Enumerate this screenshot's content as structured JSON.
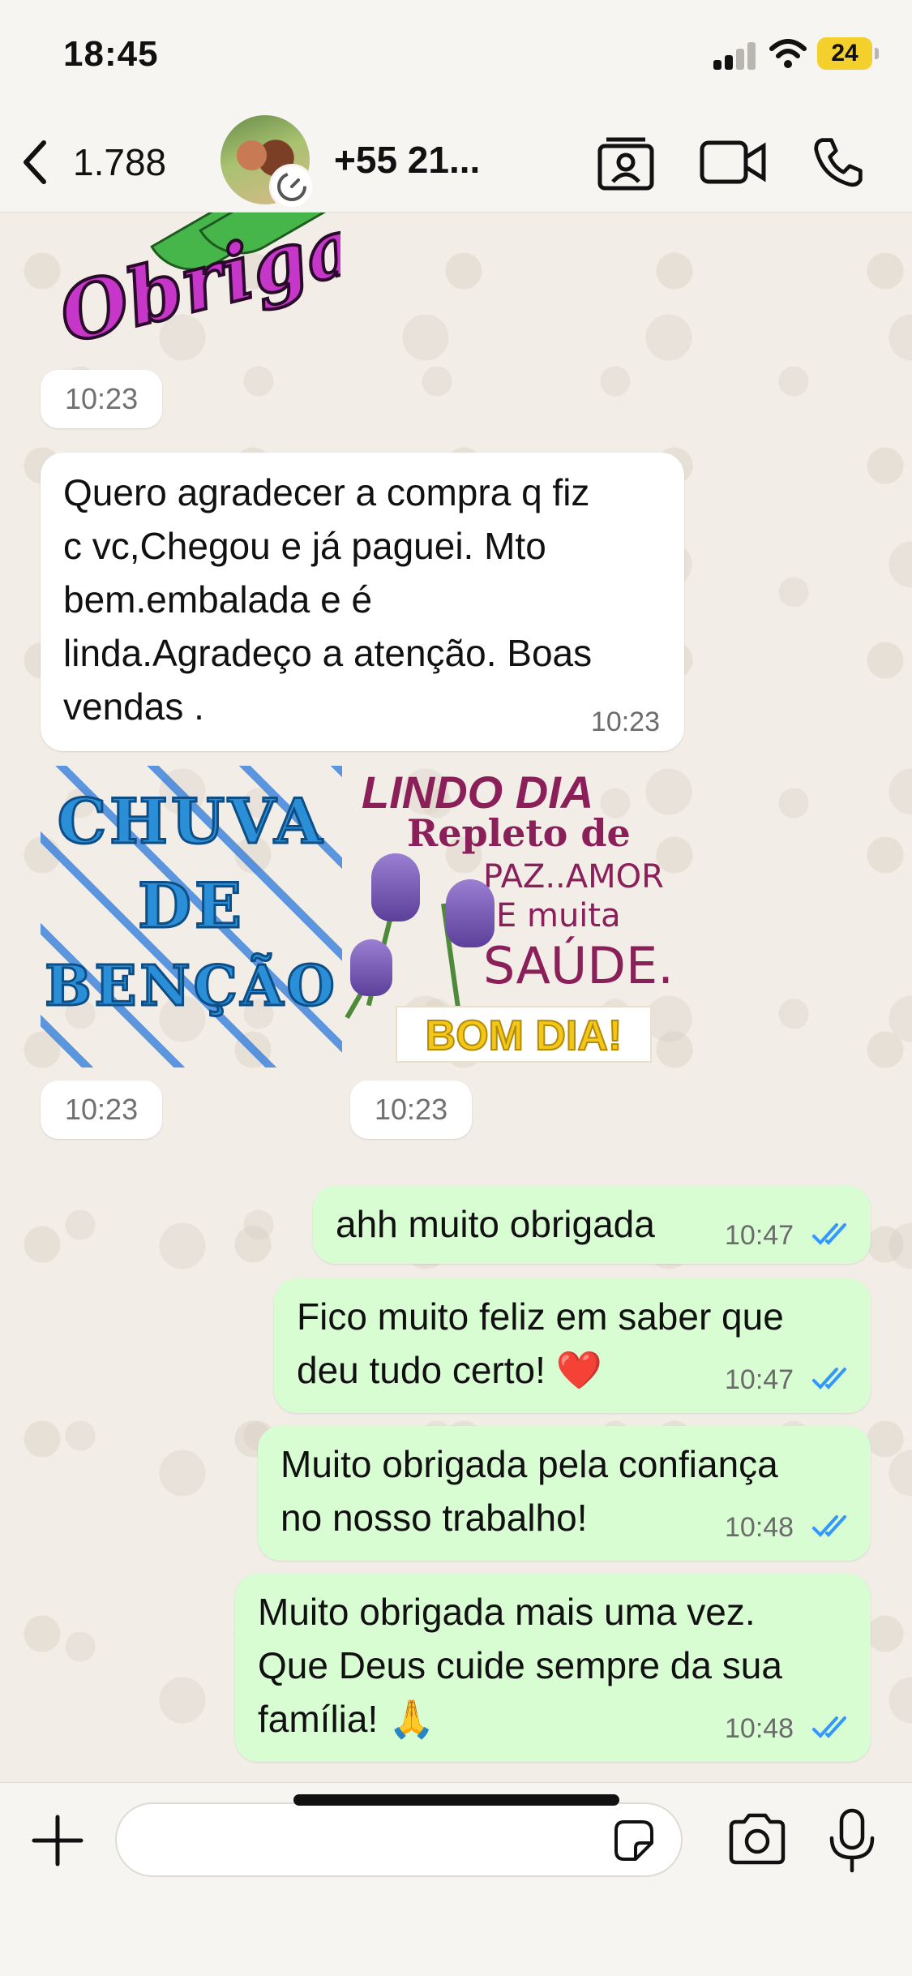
{
  "status_bar": {
    "time": "18:45",
    "battery": "24"
  },
  "header": {
    "back_count": "1.788",
    "contact_name": "+55 21..."
  },
  "messages": {
    "sticker_obrigada": {
      "text": "Obrigada!",
      "time": "10:23"
    },
    "incoming_text": {
      "lines": [
        "Quero agradecer a compra q fiz",
        "c vc,Chegou e já paguei. Mto",
        "bem.embalada e é",
        "linda.Agradeço a atenção. Boas",
        "vendas ."
      ],
      "time": "10:23"
    },
    "sticker_chuva": {
      "lines": [
        "CHUVA",
        "DE",
        "BENÇÃO"
      ],
      "time": "10:23"
    },
    "sticker_lindo": {
      "line1": "LINDO DIA",
      "line2": "Repleto de",
      "line3": "PAZ..AMOR",
      "line4": "E muita",
      "line5": "SAÚDE.",
      "line6": "BOM DIA!",
      "time": "10:23"
    },
    "outgoing": [
      {
        "lines": [
          "ahh muito obrigada"
        ],
        "time": "10:47",
        "status": "read"
      },
      {
        "lines": [
          "Fico muito feliz em saber que",
          "deu tudo certo! ❤️"
        ],
        "time": "10:47",
        "status": "read"
      },
      {
        "lines": [
          "Muito obrigada pela confiança",
          "no nosso trabalho!"
        ],
        "time": "10:48",
        "status": "read"
      },
      {
        "lines": [
          "Muito obrigada mais uma vez.",
          "Que Deus cuide sempre da sua",
          "família! 🙏"
        ],
        "time": "10:48",
        "status": "read"
      }
    ]
  },
  "composer": {
    "placeholder": ""
  },
  "colors": {
    "outgoing_bubble": "#d9fdd3",
    "read_ticks": "#3497f9",
    "background": "#f2ede6"
  }
}
